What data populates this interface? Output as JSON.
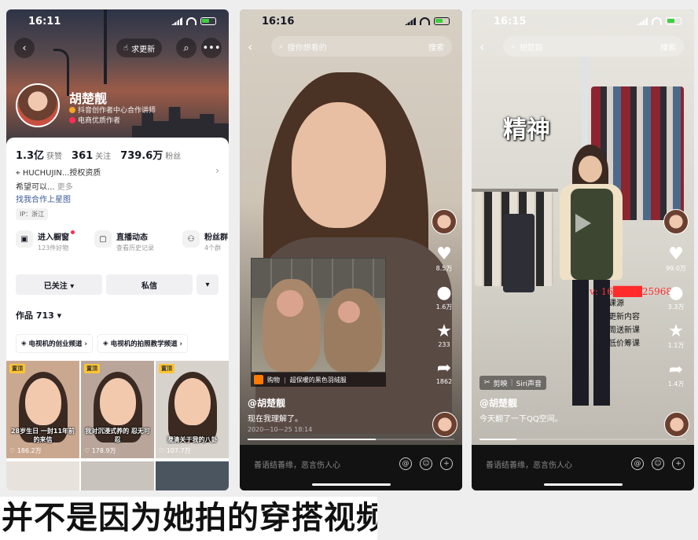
{
  "phone1": {
    "status_time": "16:11",
    "update_label": "求更新",
    "name": "胡楚靓",
    "tag1": "抖音创作者中心合作讲师",
    "tag2": "电商优质作者",
    "stats": [
      {
        "value": "1.3亿",
        "label": "获赞"
      },
      {
        "value": "361",
        "label": "关注"
      },
      {
        "value": "739.6万",
        "label": "粉丝"
      }
    ],
    "auth_line": "HUCHUJIN...授权资质",
    "bio": "希望可以...",
    "bio_more": "更多",
    "star_link": "找我合作上星图",
    "ip": "IP：浙江",
    "services": [
      {
        "icon": "shop-icon",
        "title": "进入橱窗",
        "sub": "123件好物"
      },
      {
        "icon": "live-icon",
        "title": "直播动态",
        "sub": "查看历史记录"
      },
      {
        "icon": "fans-group-icon",
        "title": "粉丝群",
        "sub": "4个群"
      }
    ],
    "followed_label": "已关注 ▾",
    "message_label": "私信",
    "more_label": "▾",
    "works_label": "作品 713 ▾",
    "channels": [
      "电视机的创业频道 ›",
      "电视机的拍照教学频道 ›"
    ],
    "tiles": [
      {
        "pin": "置顶",
        "caption": "28岁生日 一封11年前的来信",
        "likes": "♡ 186.2万",
        "bg": "#caa88f"
      },
      {
        "pin": "置顶",
        "caption": "我对沉浸式养的 忍无可忍",
        "likes": "♡ 178.9万",
        "bg": "#b9a59a"
      },
      {
        "pin": "置顶",
        "caption": "澄清关于我的八卦",
        "likes": "♡ 107.7万",
        "bg": "#d8d2cc"
      }
    ]
  },
  "phone2": {
    "status_time": "16:16",
    "search_placeholder": "搜你想看的",
    "search_btn": "搜索",
    "likes": "8.5万",
    "comments": "1.6万",
    "favs": "233",
    "shares": "1862",
    "shop_label": "购物",
    "shop_item": "超保暖的黑色羽绒服",
    "author": "@胡楚靓",
    "desc": "现在我理解了。",
    "date": "2020—10—25 18:14",
    "progress": 0.62,
    "comment_placeholder": "善语结善缘，恶言伤人心"
  },
  "phone3": {
    "status_time": "16:15",
    "search_text": "胡楚靓",
    "search_btn": "搜索",
    "overlay_word": "精神",
    "watermark_red": "v: 16████259689",
    "watermark_lines": [
      "课源",
      "更新内容",
      "周送新课",
      "低价筹课"
    ],
    "likes": "99.0万",
    "comments": "3.3万",
    "favs": "1.1万",
    "shares": "1.4万",
    "capcut_label": "剪映",
    "capcut_sub": "Siri声音",
    "author": "@胡楚靓",
    "desc": "今天翻了一下QQ空间。",
    "date": "2020—5—2 21:16",
    "progress": 0.18,
    "comment_placeholder": "善语结善缘，恶言伤人心"
  },
  "subtitle": "并不是因为她拍的穿搭视频"
}
